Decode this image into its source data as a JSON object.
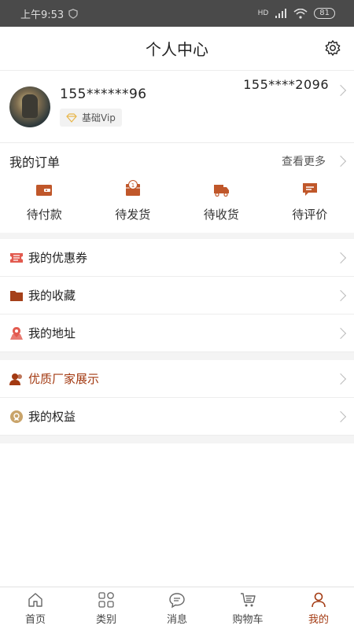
{
  "status": {
    "time": "上午9:53",
    "signal": "HD",
    "battery": "81"
  },
  "header": {
    "title": "个人中心"
  },
  "profile": {
    "name": "155******96",
    "vip_label": "基础Vip",
    "phone": "155****2096"
  },
  "orders": {
    "title": "我的订单",
    "more": "查看更多",
    "items": [
      {
        "label": "待付款",
        "icon": "wallet-icon"
      },
      {
        "label": "待发货",
        "icon": "package-icon",
        "badge": "1"
      },
      {
        "label": "待收货",
        "icon": "truck-icon"
      },
      {
        "label": "待评价",
        "icon": "comment-icon"
      }
    ]
  },
  "menu1": [
    {
      "label": "我的优惠券",
      "icon": "coupon-icon"
    },
    {
      "label": "我的收藏",
      "icon": "folder-icon"
    },
    {
      "label": "我的地址",
      "icon": "location-icon"
    }
  ],
  "menu2": [
    {
      "label": "优质厂家展示",
      "icon": "user-icon"
    },
    {
      "label": "我的权益",
      "icon": "badge-icon"
    }
  ],
  "tabs": [
    {
      "label": "首页",
      "icon": "home-icon"
    },
    {
      "label": "类别",
      "icon": "grid-icon"
    },
    {
      "label": "消息",
      "icon": "message-icon"
    },
    {
      "label": "购物车",
      "icon": "cart-icon"
    },
    {
      "label": "我的",
      "icon": "person-icon",
      "active": true
    }
  ],
  "colors": {
    "accent": "#a33a12",
    "order_icon": "#c0572a",
    "coupon": "#e25a4f",
    "folder": "#a5401a",
    "location": "#e25a4f",
    "vendor": "#a33a12",
    "rights": "#c9a46a"
  }
}
